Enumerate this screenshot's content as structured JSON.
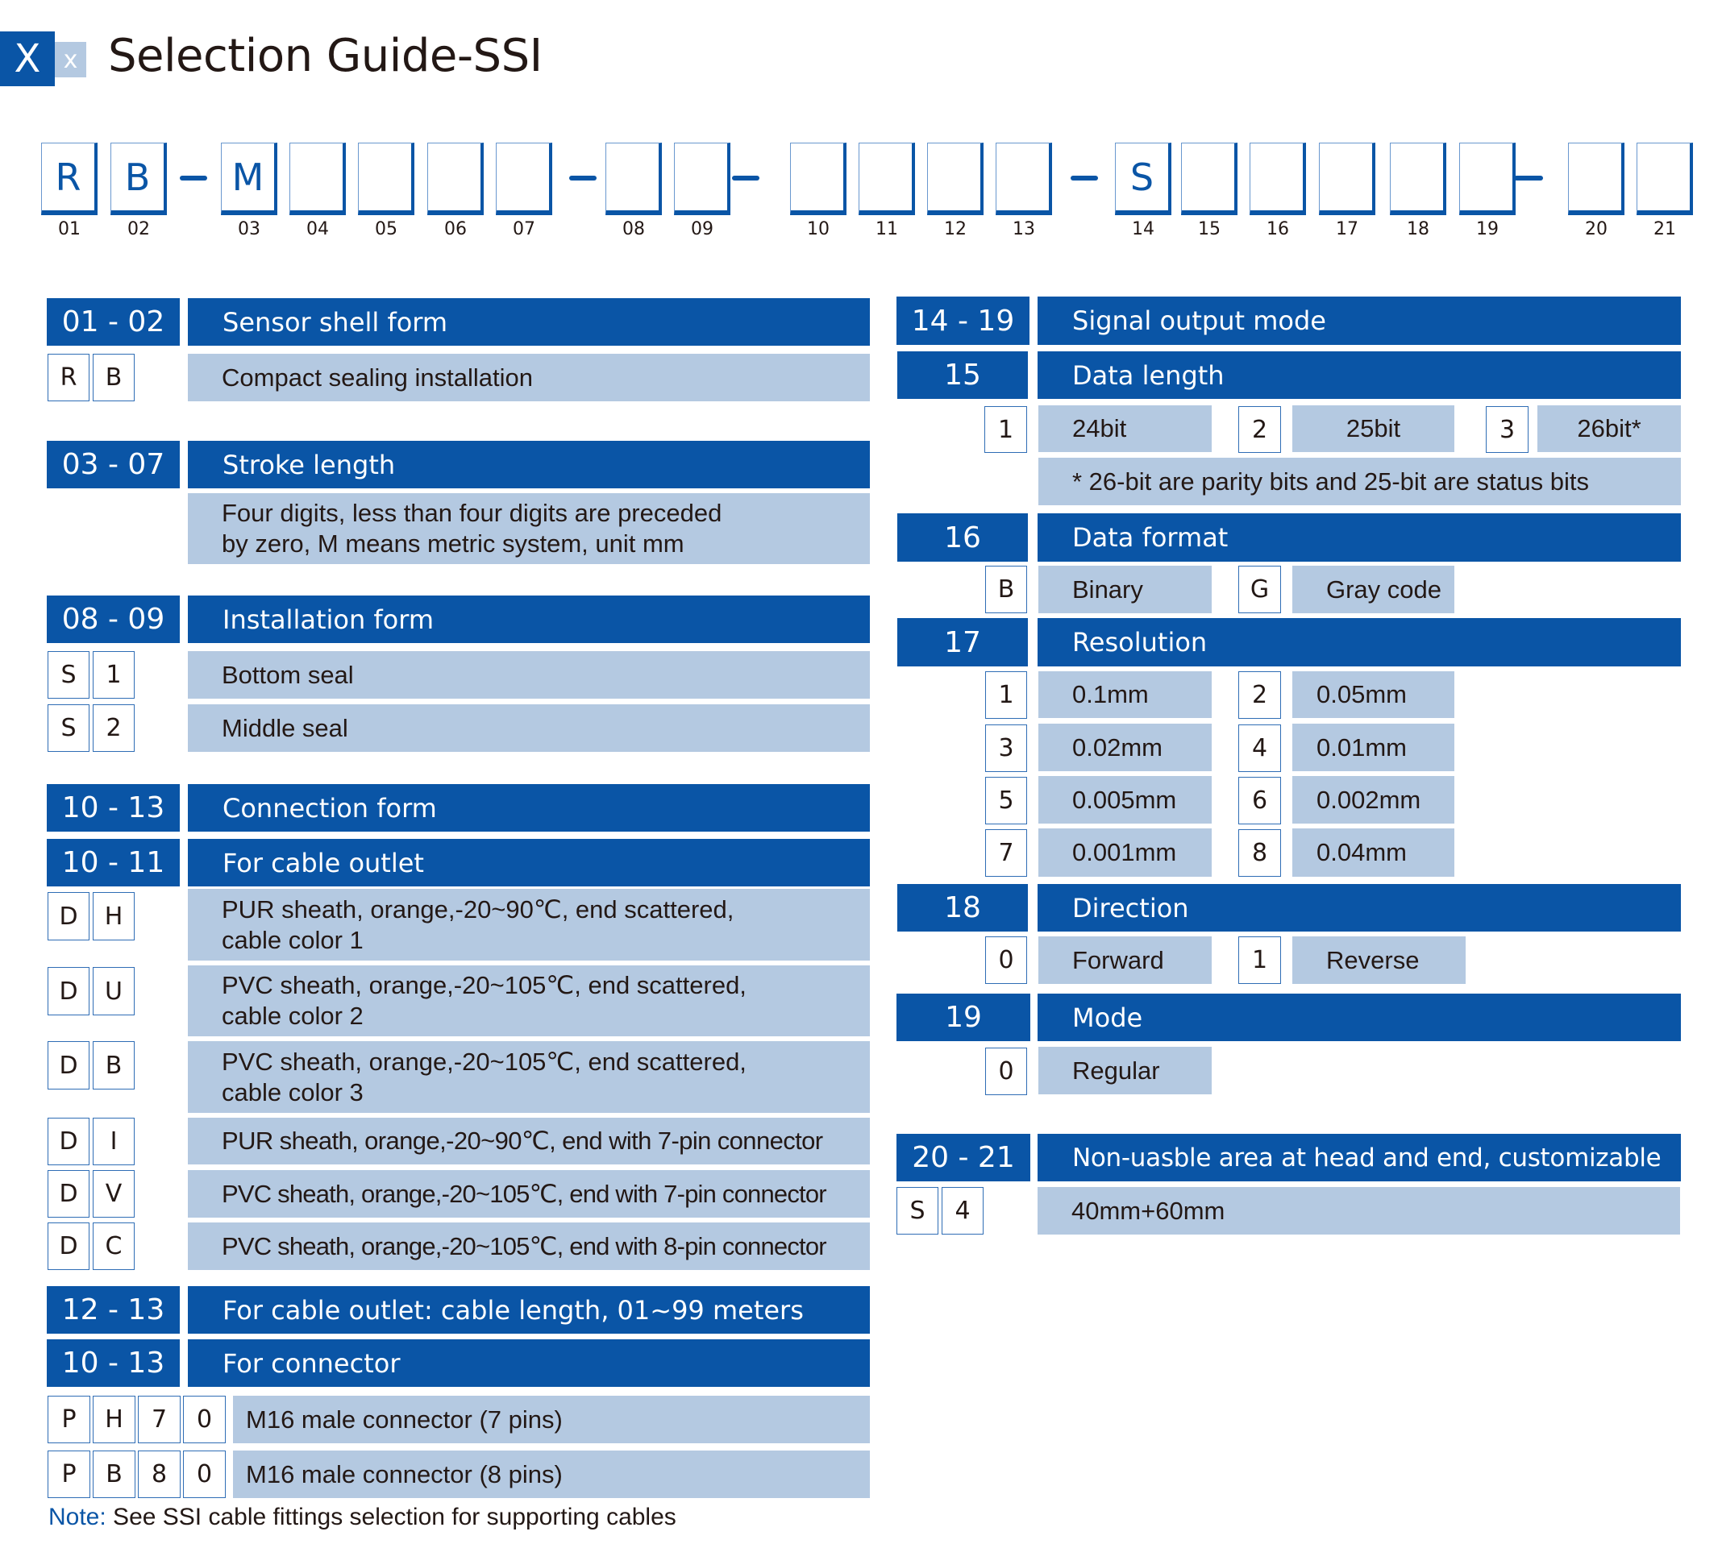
{
  "header": {
    "logo_big": "X",
    "logo_small": "x",
    "title": "Selection Guide-SSI"
  },
  "colors": {
    "accent": "#0a55a6",
    "accent_light": "#b4c9e1",
    "text": "#231815"
  },
  "code": {
    "boxes": [
      {
        "pos": "01",
        "value": "R"
      },
      {
        "pos": "02",
        "value": "B"
      },
      {
        "pos": "03",
        "value": "M"
      },
      {
        "pos": "04",
        "value": ""
      },
      {
        "pos": "05",
        "value": ""
      },
      {
        "pos": "06",
        "value": ""
      },
      {
        "pos": "07",
        "value": ""
      },
      {
        "pos": "08",
        "value": ""
      },
      {
        "pos": "09",
        "value": ""
      },
      {
        "pos": "10",
        "value": ""
      },
      {
        "pos": "11",
        "value": ""
      },
      {
        "pos": "12",
        "value": ""
      },
      {
        "pos": "13",
        "value": ""
      },
      {
        "pos": "14",
        "value": "S"
      },
      {
        "pos": "15",
        "value": ""
      },
      {
        "pos": "16",
        "value": ""
      },
      {
        "pos": "17",
        "value": ""
      },
      {
        "pos": "18",
        "value": ""
      },
      {
        "pos": "19",
        "value": ""
      },
      {
        "pos": "20",
        "value": ""
      },
      {
        "pos": "21",
        "value": ""
      }
    ]
  },
  "left": {
    "shell": {
      "code": "01 - 02",
      "title": "Sensor shell form",
      "options": [
        {
          "chars": [
            "R",
            "B"
          ],
          "desc": "Compact sealing installation"
        }
      ]
    },
    "stroke": {
      "code": "03 - 07",
      "title": "Stroke length",
      "desc_line1": "Four digits, less than four digits are preceded",
      "desc_line2": "by zero, M means metric system, unit mm"
    },
    "install": {
      "code": "08 - 09",
      "title": "Installation form",
      "options": [
        {
          "chars": [
            "S",
            "1"
          ],
          "desc": "Bottom seal"
        },
        {
          "chars": [
            "S",
            "2"
          ],
          "desc": "Middle seal"
        }
      ]
    },
    "connection": {
      "code": "10 - 13",
      "title": "Connection form"
    },
    "cable_outlet": {
      "code": "10 - 11",
      "title": "For cable outlet",
      "options": [
        {
          "chars": [
            "D",
            "H"
          ],
          "line1": "PUR sheath, orange,-20~90℃, end scattered,",
          "line2": "cable color 1"
        },
        {
          "chars": [
            "D",
            "U"
          ],
          "line1": "PVC sheath, orange,-20~105℃, end scattered,",
          "line2": "cable color 2"
        },
        {
          "chars": [
            "D",
            "B"
          ],
          "line1": "PVC sheath, orange,-20~105℃, end scattered,",
          "line2": "cable color 3"
        },
        {
          "chars": [
            "D",
            "I"
          ],
          "line1": "PUR sheath, orange,-20~90℃, end with 7-pin connector"
        },
        {
          "chars": [
            "D",
            "V"
          ],
          "line1": "PVC sheath, orange,-20~105℃, end with 7-pin connector"
        },
        {
          "chars": [
            "D",
            "C"
          ],
          "line1": "PVC sheath, orange,-20~105℃, end with 8-pin connector"
        }
      ]
    },
    "cable_length": {
      "code": "12 - 13",
      "title": "For cable outlet: cable length, 01~99 meters"
    },
    "connector": {
      "code": "10 - 13",
      "title": "For connector",
      "options": [
        {
          "chars": [
            "P",
            "H",
            "7",
            "0"
          ],
          "desc": "M16 male connector (7 pins)"
        },
        {
          "chars": [
            "P",
            "B",
            "8",
            "0"
          ],
          "desc": "M16 male connector (8 pins)"
        }
      ]
    },
    "note": {
      "label": "Note:",
      "text": " See SSI cable fittings selection for supporting cables"
    }
  },
  "right": {
    "signal": {
      "code": "14 - 19",
      "title": "Signal output mode"
    },
    "data_length": {
      "code": "15",
      "title": "Data length",
      "options": [
        {
          "key": "1",
          "label": "24bit"
        },
        {
          "key": "2",
          "label": "25bit"
        },
        {
          "key": "3",
          "label": "26bit*"
        }
      ],
      "footnote": "* 26-bit are parity bits and 25-bit are status bits"
    },
    "data_format": {
      "code": "16",
      "title": "Data format",
      "options": [
        {
          "key": "B",
          "label": "Binary"
        },
        {
          "key": "G",
          "label": "Gray code"
        }
      ]
    },
    "resolution": {
      "code": "17",
      "title": "Resolution",
      "options": [
        {
          "key": "1",
          "label": "0.1mm"
        },
        {
          "key": "2",
          "label": "0.05mm"
        },
        {
          "key": "3",
          "label": "0.02mm"
        },
        {
          "key": "4",
          "label": "0.01mm"
        },
        {
          "key": "5",
          "label": "0.005mm"
        },
        {
          "key": "6",
          "label": "0.002mm"
        },
        {
          "key": "7",
          "label": "0.001mm"
        },
        {
          "key": "8",
          "label": "0.04mm"
        }
      ]
    },
    "direction": {
      "code": "18",
      "title": "Direction",
      "options": [
        {
          "key": "0",
          "label": "Forward"
        },
        {
          "key": "1",
          "label": "Reverse"
        }
      ]
    },
    "mode": {
      "code": "19",
      "title": "Mode",
      "options": [
        {
          "key": "0",
          "label": "Regular"
        }
      ]
    },
    "nonusable": {
      "code": "20 - 21",
      "title": "Non-uasble area at head and end, customizable",
      "options": [
        {
          "chars": [
            "S",
            "4"
          ],
          "desc": "40mm+60mm"
        }
      ]
    }
  }
}
